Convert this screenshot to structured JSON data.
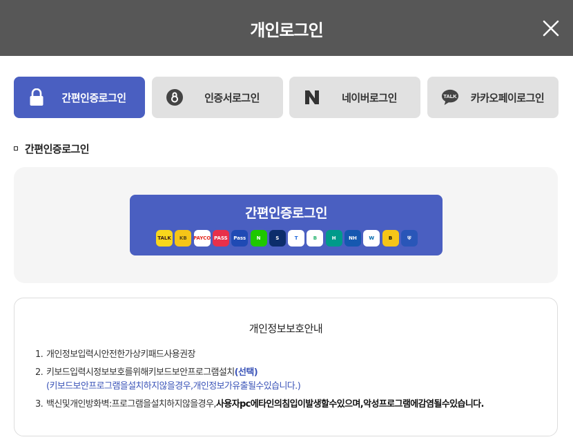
{
  "header": {
    "title": "개인로그인"
  },
  "tabs": [
    {
      "label": "간편인증로그인",
      "icon": "lock-icon",
      "active": true
    },
    {
      "label": "인증서로그인",
      "icon": "certificate-icon",
      "active": false
    },
    {
      "label": "네이버로그인",
      "icon": "naver-icon",
      "active": false
    },
    {
      "label": "카카오페이로그인",
      "icon": "kakao-talk-icon",
      "active": false
    }
  ],
  "section": {
    "title": "간편인증로그인"
  },
  "login": {
    "button_label": "간편인증로그인",
    "providers": [
      {
        "icon": "kakao-talk-icon",
        "bg": "#f9d71c",
        "text": "TALK",
        "fg": "#3a1d1d"
      },
      {
        "icon": "kb-icon",
        "bg": "#f5c518",
        "text": "KB",
        "fg": "#5a4a1a"
      },
      {
        "icon": "payco-icon",
        "bg": "#ffffff",
        "text": "PAYCO",
        "fg": "#e2231a"
      },
      {
        "icon": "pass-icon",
        "bg": "#e8304a",
        "text": "PASS",
        "fg": "#ffffff"
      },
      {
        "icon": "samsung-pass-icon",
        "bg": "#1f4ab4",
        "text": "Pass",
        "fg": "#ffffff"
      },
      {
        "icon": "naver-icon",
        "bg": "#1ec800",
        "text": "N",
        "fg": "#ffffff"
      },
      {
        "icon": "shinhan-icon",
        "bg": "#0c2d6b",
        "text": "S",
        "fg": "#ffffff"
      },
      {
        "icon": "toss-icon",
        "bg": "#ffffff",
        "text": "T",
        "fg": "#1b64da"
      },
      {
        "icon": "banksalad-icon",
        "bg": "#ffffff",
        "text": "B",
        "fg": "#23b26d"
      },
      {
        "icon": "hana-icon",
        "bg": "#009a8a",
        "text": "H",
        "fg": "#ffffff"
      },
      {
        "icon": "nh-icon",
        "bg": "#1558b0",
        "text": "NH",
        "fg": "#ffffff"
      },
      {
        "icon": "woori-icon",
        "bg": "#ffffff",
        "text": "W",
        "fg": "#0067ac"
      },
      {
        "icon": "banks-icon",
        "bg": "#f5c518",
        "text": "B",
        "fg": "#111111"
      },
      {
        "icon": "shield-icon",
        "bg": "#2956b8",
        "text": "⛨",
        "fg": "#ffffff"
      }
    ]
  },
  "privacy": {
    "title": "개인정보보호안내",
    "item1": {
      "num": "1.",
      "text": "개인정보입력시안전한가상키패드사용권장"
    },
    "item2": {
      "num": "2.",
      "text": "키보드입력시정보보호를위해키보드보안프로그램설치",
      "accent": "(선택)",
      "sub": "(키보드보안프로그램을설치하지않을경우,개인정보가유출될수있습니다.)"
    },
    "item3": {
      "num": "3.",
      "text": "백신및개인방화벽:프로그램을설치하지않을경우,",
      "strong": "사용자pc에타인의침입이발생할수있으며,악성프로그램에감염될수있습니다."
    }
  },
  "colors": {
    "header_bg": "#575757",
    "accent": "#4a5fc1",
    "tab_inactive": "#e1e1e1",
    "panel_bg": "#f5f5f5"
  }
}
